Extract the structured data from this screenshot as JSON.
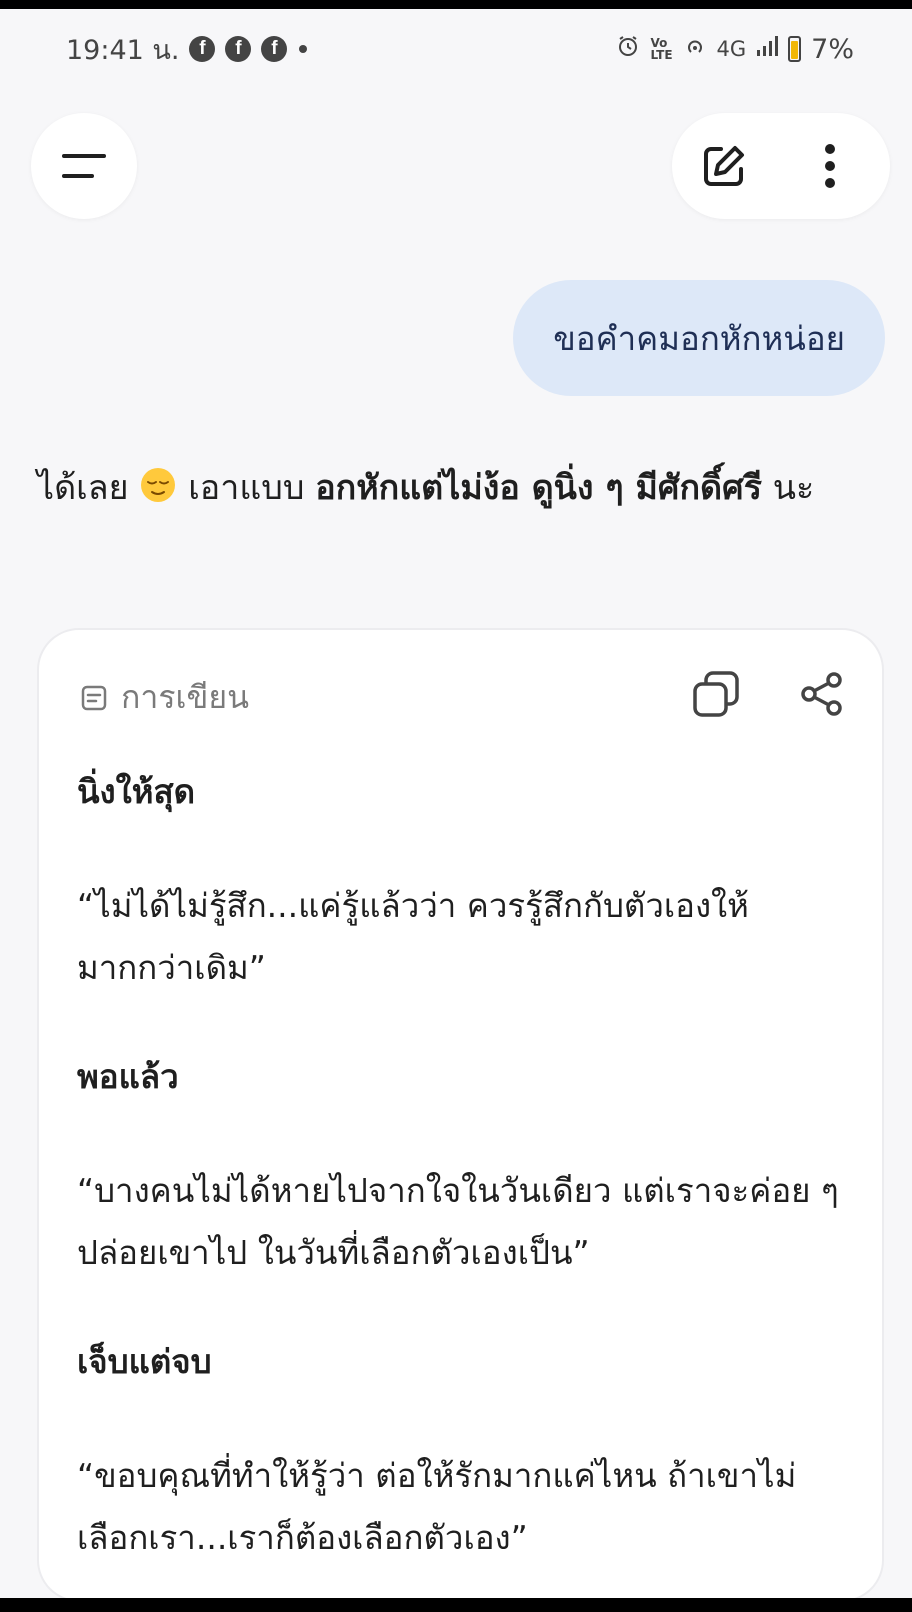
{
  "status_bar": {
    "time": "19:41 น.",
    "network": "4G",
    "battery": "7%"
  },
  "top_bar": {
    "menu_icon": "menu-icon",
    "new_chat_icon": "edit-icon",
    "more_icon": "more-vert-icon"
  },
  "user_message": "ขอคำคมอกหักหน่อย",
  "reply": {
    "prefix": "ได้เลย",
    "emoji": "relieved-face-emoji",
    "middle": "เอาแบบ",
    "bold": "อกหักแต่ไม่ง้อ ดูนิ่ง ๆ มีศักดิ์ศรี",
    "suffix": "นะ"
  },
  "card": {
    "label": "การเขียน",
    "sections": [
      {
        "title": "นิ่งให้สุด",
        "quote": "“ไม่ได้ไม่รู้สึก...แค่รู้แล้วว่า ควรรู้สึกกับตัวเองให้มากกว่าเดิม”"
      },
      {
        "title": "พอแล้ว",
        "quote": "“บางคนไม่ได้หายไปจากใจในวันเดียว แต่เราจะค่อย ๆ ปล่อยเขาไป ในวันที่เลือกตัวเองเป็น”"
      },
      {
        "title": "เจ็บแต่จบ",
        "quote": "“ขอบคุณที่ทำให้รู้ว่า ต่อให้รักมากแค่ไหน ถ้าเขาไม่เลือกเรา...เราก็ต้องเลือกตัวเอง”"
      }
    ]
  }
}
